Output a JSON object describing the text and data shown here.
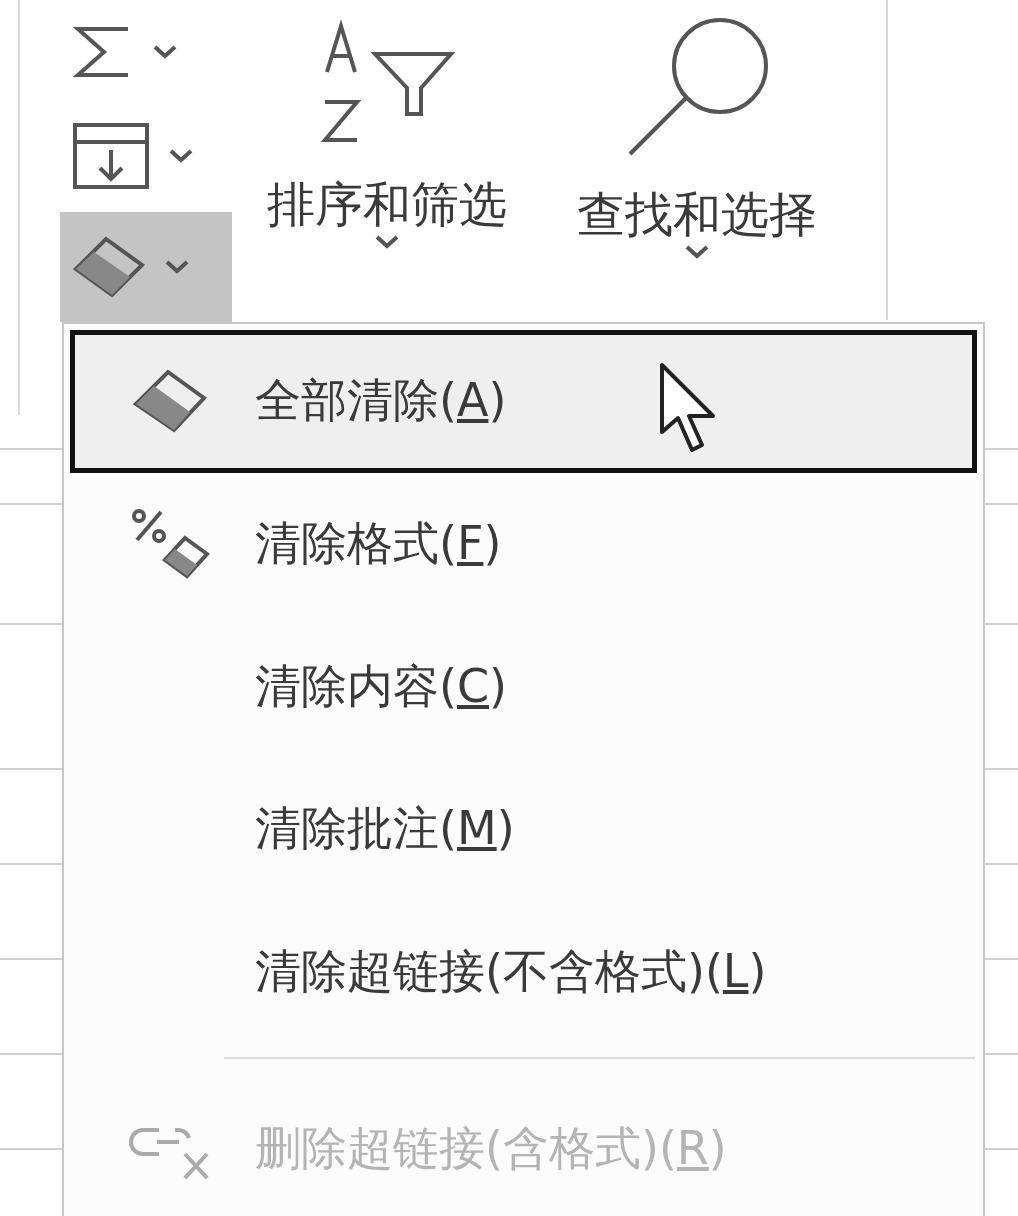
{
  "ribbon": {
    "small_buttons": [
      {
        "kind": "sum",
        "pressed": false
      },
      {
        "kind": "fill",
        "pressed": false
      },
      {
        "kind": "clear",
        "pressed": true
      }
    ],
    "large_buttons": [
      {
        "kind": "sort_filter",
        "label": "排序和筛选"
      },
      {
        "kind": "find_select",
        "label": "查找和选择"
      }
    ]
  },
  "menu": {
    "items": [
      {
        "kind": "clear_all",
        "before": "全部清除(",
        "accelerator": "A",
        "after": ")",
        "hovered": true,
        "disabled": false
      },
      {
        "kind": "clear_formats",
        "before": "清除格式(",
        "accelerator": "F",
        "after": ")",
        "hovered": false,
        "disabled": false
      },
      {
        "kind": "command",
        "before": "清除内容(",
        "accelerator": "C",
        "after": ")",
        "hovered": false,
        "disabled": false
      },
      {
        "kind": "command",
        "before": "清除批注(",
        "accelerator": "M",
        "after": ")",
        "hovered": false,
        "disabled": false
      },
      {
        "kind": "command",
        "before": "清除超链接(不含格式)(",
        "accelerator": "L",
        "after": ")",
        "hovered": false,
        "disabled": false
      },
      {
        "kind": "separator"
      },
      {
        "kind": "remove_links",
        "before": "删除超链接(含格式)(",
        "accelerator": "R",
        "after": ")",
        "hovered": false,
        "disabled": true
      }
    ]
  }
}
